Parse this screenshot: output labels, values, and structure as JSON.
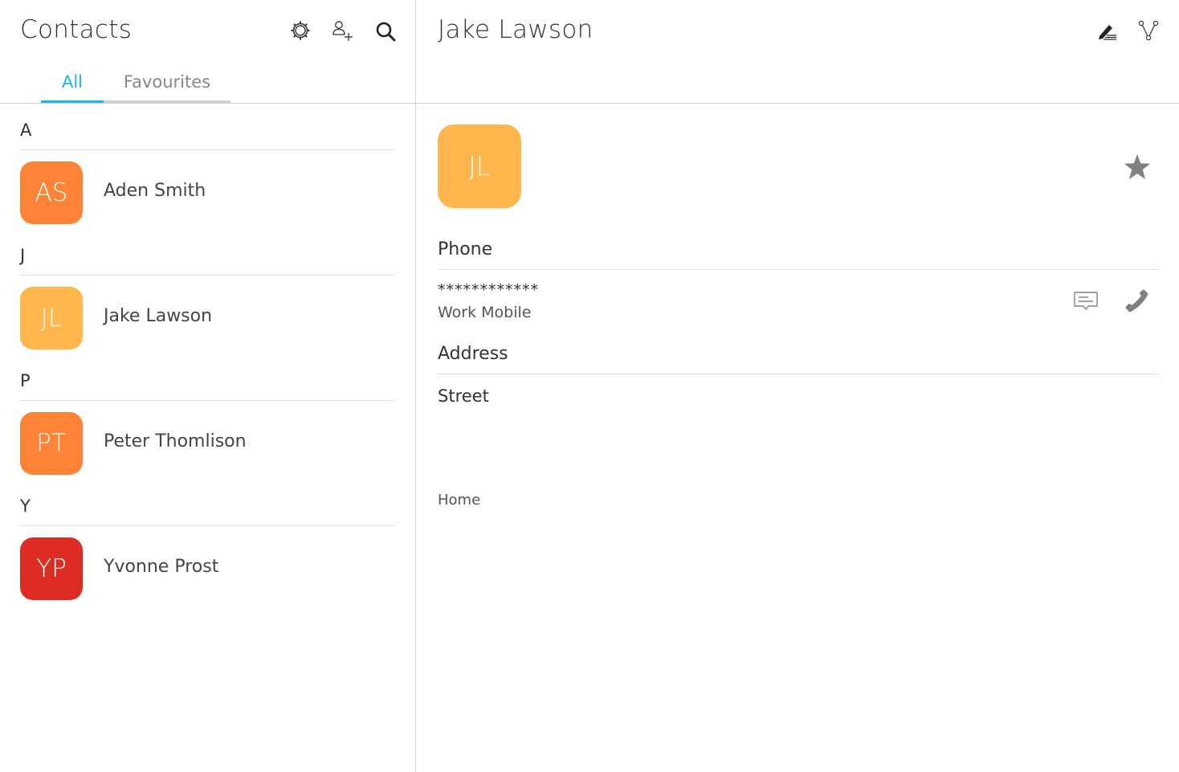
{
  "list_header": {
    "title": "Contacts",
    "settings_icon": "gear-icon",
    "add_contact_icon": "add-contact-icon",
    "search_icon": "search-icon"
  },
  "tabs": [
    {
      "label": "All",
      "active": true
    },
    {
      "label": "Favourites",
      "active": false
    }
  ],
  "sections": [
    {
      "letter": "A",
      "contacts": [
        {
          "initials": "AS",
          "name": "Aden Smith",
          "color": "#fd8436"
        }
      ]
    },
    {
      "letter": "J",
      "contacts": [
        {
          "initials": "JL",
          "name": "Jake Lawson",
          "color": "#ffb74d"
        }
      ]
    },
    {
      "letter": "P",
      "contacts": [
        {
          "initials": "PT",
          "name": "Peter Thomlison",
          "color": "#fd8436"
        }
      ]
    },
    {
      "letter": "Y",
      "contacts": [
        {
          "initials": "YP",
          "name": "Yvonne Prost",
          "color": "#dc2c23"
        }
      ]
    }
  ],
  "detail": {
    "title": "Jake Lawson",
    "edit_icon": "edit-icon",
    "share_icon": "share-icon",
    "avatar_initials": "JL",
    "avatar_color": "#ffb74d",
    "favourite_icon": "star-icon",
    "phone": {
      "heading": "Phone",
      "number": "************",
      "type": "Work Mobile",
      "message_icon": "message-icon",
      "call_icon": "phone-icon"
    },
    "address": {
      "heading": "Address",
      "street": "Street",
      "type": "Home"
    }
  },
  "colors": {
    "accent": "#19b6ee",
    "icon_gray": "#808080"
  }
}
